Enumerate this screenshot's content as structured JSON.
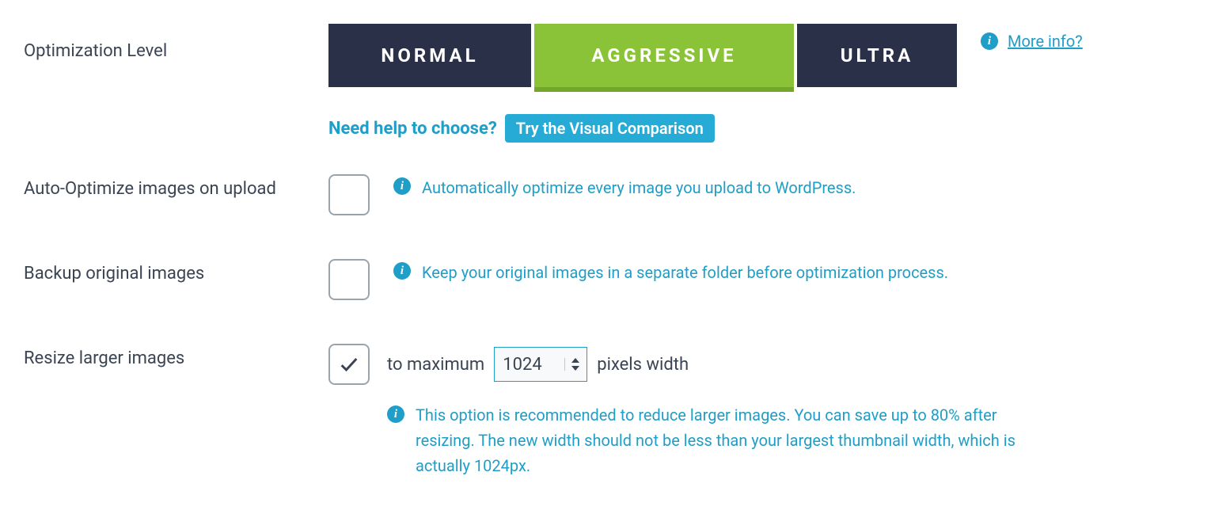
{
  "optimization_level": {
    "label": "Optimization Level",
    "options": {
      "normal": "NORMAL",
      "aggressive": "AGGRESSIVE",
      "ultra": "ULTRA"
    },
    "selected": "aggressive",
    "more_info": "More info?",
    "help_text": "Need help to choose?",
    "help_button": "Try the Visual Comparison"
  },
  "auto_optimize": {
    "label": "Auto-Optimize images on upload",
    "checked": false,
    "description": "Automatically optimize every image you upload to WordPress."
  },
  "backup": {
    "label": "Backup original images",
    "checked": false,
    "description": "Keep your original images in a separate folder before optimization process."
  },
  "resize": {
    "label": "Resize larger images",
    "checked": true,
    "prefix": "to maximum",
    "value": "1024",
    "suffix": "pixels width",
    "description": "This option is recommended to reduce larger images. You can save up to 80% after resizing. The new width should not be less than your largest thumbnail width, which is actually 1024px."
  },
  "info_glyph": "i"
}
